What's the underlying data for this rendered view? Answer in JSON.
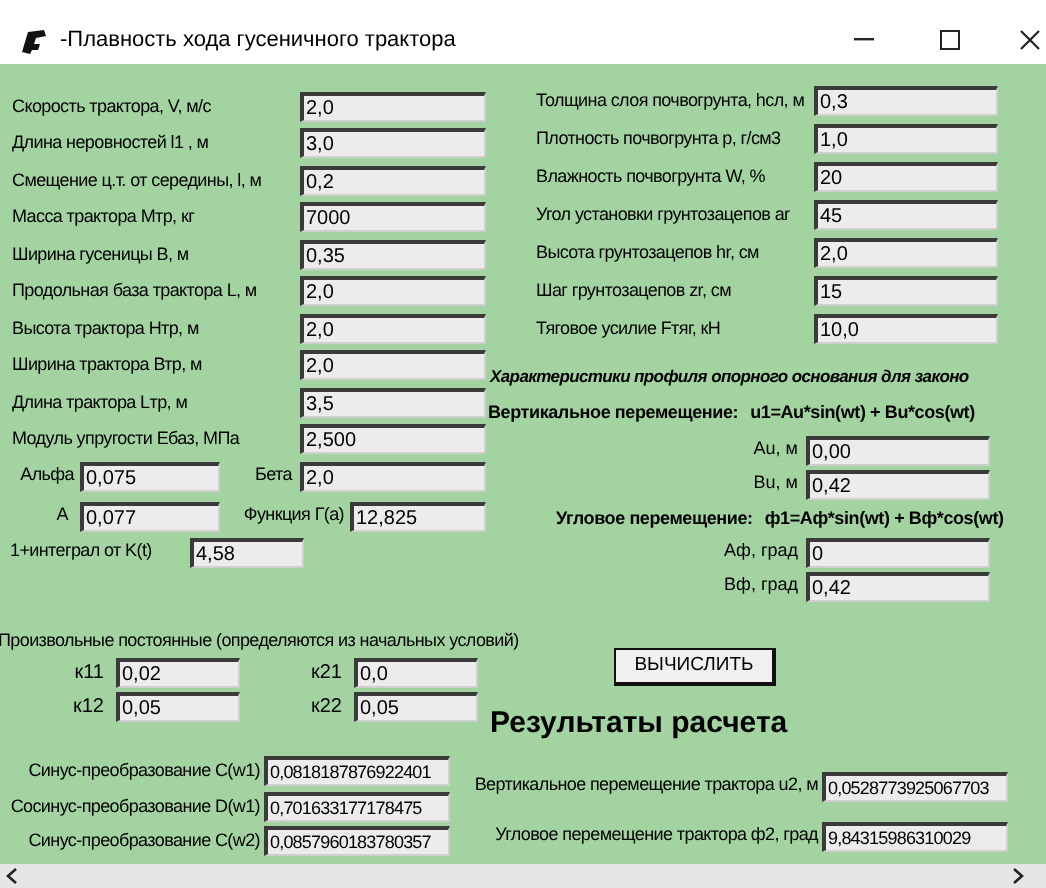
{
  "window": {
    "title": "-Плавность хода гусеничного трактора"
  },
  "tractor_fields": [
    {
      "label": "Скорость трактора, V, м/с",
      "value": "2,0"
    },
    {
      "label": "Длина неровностей  l1 , м",
      "value": "3,0"
    },
    {
      "label": "Смещение ц.т. от середины, l, м",
      "value": "0,2"
    },
    {
      "label": "Масса трактора Мтр, кг",
      "value": "7000"
    },
    {
      "label": "Ширина гусеницы B, м",
      "value": "0,35"
    },
    {
      "label": "Продольная база трактора L, м",
      "value": "2,0"
    },
    {
      "label": "Высота трактора Нтр, м",
      "value": "2,0"
    },
    {
      "label": "Ширина трактора Втр, м",
      "value": "2,0"
    },
    {
      "label": "Длина трактора Lтр, м",
      "value": "3,5"
    },
    {
      "label": "Модуль упругости Ебаз, МПа",
      "value": "2,500"
    }
  ],
  "function_fields": [
    {
      "label": "Альфа",
      "value": "0,075"
    },
    {
      "label": "Бета",
      "value": "2,0"
    },
    {
      "label": "A",
      "value": "0,077"
    },
    {
      "label": "Функция Г(a)",
      "value": "12,825"
    }
  ],
  "integral": {
    "label": "1+интеграл от K(t)",
    "value": "4,58"
  },
  "soil_fields": [
    {
      "label": "Толщина слоя почвогрунта, hсл, м",
      "value": "0,3"
    },
    {
      "label": "Плотность почвогрунта p, г/см3",
      "value": "1,0"
    },
    {
      "label": "Влажность почвогрунта W, %",
      "value": "20"
    },
    {
      "label": "Угол установки грунтозацепов ar",
      "value": "45"
    },
    {
      "label": "Высота грунтозацепов hr, см",
      "value": "2,0"
    },
    {
      "label": "Шаг грунтозацепов zr, см",
      "value": "15"
    },
    {
      "label": "Тяговое усилие Fтяг, кН",
      "value": "10,0"
    }
  ],
  "profile": {
    "heading": "Характеристики профиля опорного основания для законо",
    "vertical": {
      "title": "Вертикальное перемещение:",
      "formula": "u1=Au*sin(wt) + Bu*cos(wt)",
      "fields": [
        {
          "label": "Au, м",
          "value": "0,00"
        },
        {
          "label": "Bu, м",
          "value": "0,42"
        }
      ]
    },
    "angular": {
      "title": "Угловое перемещение:",
      "formula": "ф1=Aф*sin(wt) + Bф*cos(wt)",
      "fields": [
        {
          "label": "Aф, град",
          "value": "0"
        },
        {
          "label": "Bф, град",
          "value": "0,42"
        }
      ]
    }
  },
  "constants": {
    "heading": "Произвольные постоянные (определяются из начальных условий)",
    "fields": [
      {
        "label": "к11",
        "value": "0,02"
      },
      {
        "label": "к21",
        "value": "0,0"
      },
      {
        "label": "к12",
        "value": "0,05"
      },
      {
        "label": "к22",
        "value": "0,05"
      }
    ]
  },
  "calculate_button": "ВЫЧИСЛИТЬ",
  "results": {
    "heading": "Результаты расчета",
    "transforms": [
      {
        "label": "Синус-преобразование C(w1)",
        "value": "0,0818187876922401"
      },
      {
        "label": "Сосинус-преобразование D(w1)",
        "value": "0,701633177178475"
      },
      {
        "label": "Синус-преобразование C(w2)",
        "value": "0,0857960183780357"
      }
    ],
    "displacements": [
      {
        "label": "Вертикальное перемещение трактора u2, м",
        "value": "0,0528773925067703"
      },
      {
        "label": "Угловое перемещение трактора ф2, град",
        "value": "9,84315986310029"
      }
    ]
  }
}
